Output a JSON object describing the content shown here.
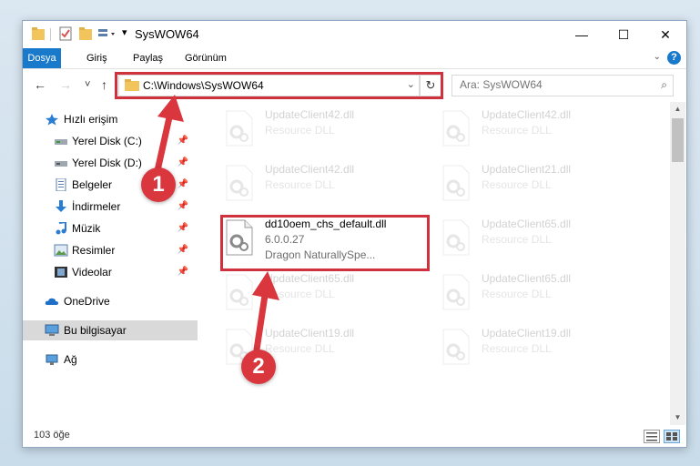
{
  "window": {
    "title": "SysWOW64",
    "minimize_glyph": "—",
    "maximize_glyph": "☐",
    "close_glyph": "✕"
  },
  "ribbon": {
    "tabs": [
      "Dosya",
      "Giriş",
      "Paylaş",
      "Görünüm"
    ],
    "help_label": "?",
    "expand_glyph": "⌄"
  },
  "nav": {
    "back_glyph": "←",
    "forward_glyph": "→",
    "recent_glyph": "˅",
    "up_glyph": "↑",
    "address": "C:\\Windows\\SysWOW64",
    "dropdown_glyph": "⌄",
    "refresh_glyph": "↻",
    "search_placeholder": "Ara: SysWOW64",
    "search_glyph": "⌕"
  },
  "sidebar": {
    "quick_access": "Hızlı erişim",
    "items": [
      {
        "label": "Yerel Disk (C:)",
        "icon": "drive-icon"
      },
      {
        "label": "Yerel Disk (D:)",
        "icon": "drive-icon"
      },
      {
        "label": "Belgeler",
        "icon": "documents-icon"
      },
      {
        "label": "İndirmeler",
        "icon": "downloads-icon"
      },
      {
        "label": "Müzik",
        "icon": "music-icon"
      },
      {
        "label": "Resimler",
        "icon": "pictures-icon"
      },
      {
        "label": "Videolar",
        "icon": "videos-icon"
      }
    ],
    "pin_glyph": "📌",
    "onedrive": "OneDrive",
    "this_pc": "Bu bilgisayar",
    "network": "Ağ"
  },
  "files": {
    "left": [
      {
        "name": "UpdateClient42.dll",
        "line2": "Resource DLL",
        "line3": "",
        "faded": true
      },
      {
        "name": "UpdateClient42.dll",
        "line2": "Resource DLL",
        "line3": "",
        "faded": true
      },
      {
        "name": "dd10oem_chs_default.dll",
        "line2": "6.0.0.27",
        "line3": "Dragon NaturallySpe...",
        "faded": false
      },
      {
        "name": "UpdateClient65.dll",
        "line2": "Resource DLL",
        "line3": "",
        "faded": true
      },
      {
        "name": "UpdateClient19.dll",
        "line2": "Resource DLL",
        "line3": "",
        "faded": true
      }
    ],
    "right": [
      {
        "name": "UpdateClient42.dll",
        "line2": "Resource DLL",
        "line3": "",
        "faded": true
      },
      {
        "name": "UpdateClient21.dll",
        "line2": "Resource DLL",
        "line3": "",
        "faded": true
      },
      {
        "name": "UpdateClient65.dll",
        "line2": "Resource DLL",
        "line3": "",
        "faded": true
      },
      {
        "name": "UpdateClient65.dll",
        "line2": "Resource DLL",
        "line3": "",
        "faded": true
      },
      {
        "name": "UpdateClient19.dll",
        "line2": "Resource DLL",
        "line3": "",
        "faded": true
      }
    ]
  },
  "status": {
    "item_count": "103 öğe"
  },
  "annotations": {
    "step1": "1",
    "step2": "2",
    "highlight_color": "#d0323d"
  }
}
